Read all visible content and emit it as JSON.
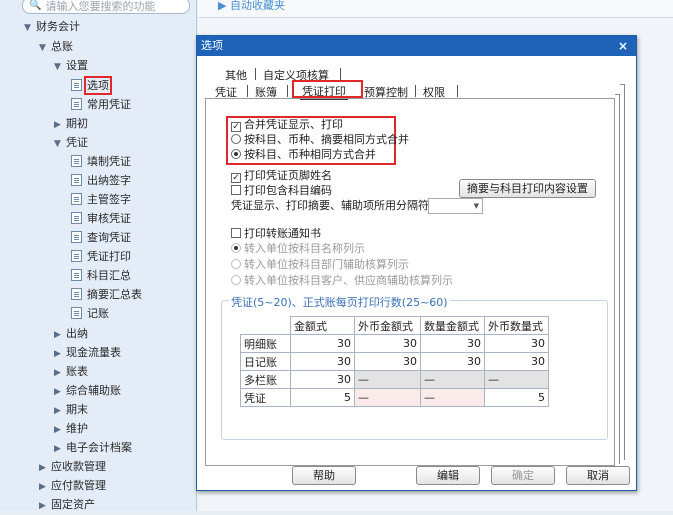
{
  "sidebar": {
    "search_placeholder": "请输入您要搜索的功能",
    "tree": [
      {
        "label": "财务会计",
        "arrow": "▼"
      },
      {
        "label": "总账",
        "arrow": "▼"
      },
      {
        "label": "设置",
        "arrow": "▼"
      },
      {
        "label": "选项",
        "icon": "doc"
      },
      {
        "label": "常用凭证",
        "icon": "doc"
      },
      {
        "label": "期初",
        "arrow": "▶"
      },
      {
        "label": "凭证",
        "arrow": "▼"
      },
      {
        "label": "填制凭证",
        "icon": "doc"
      },
      {
        "label": "出纳签字",
        "icon": "doc"
      },
      {
        "label": "主管签字",
        "icon": "doc"
      },
      {
        "label": "审核凭证",
        "icon": "doc"
      },
      {
        "label": "查询凭证",
        "icon": "doc"
      },
      {
        "label": "凭证打印",
        "icon": "doc"
      },
      {
        "label": "科目汇总",
        "icon": "doc"
      },
      {
        "label": "摘要汇总表",
        "icon": "doc"
      },
      {
        "label": "记账",
        "icon": "doc"
      },
      {
        "label": "出纳",
        "arrow": "▶"
      },
      {
        "label": "现金流量表",
        "arrow": "▶"
      },
      {
        "label": "账表",
        "arrow": "▶"
      },
      {
        "label": "综合辅助账",
        "arrow": "▶"
      },
      {
        "label": "期末",
        "arrow": "▶"
      },
      {
        "label": "维护",
        "arrow": "▶"
      },
      {
        "label": "电子会计档案",
        "arrow": "▶"
      },
      {
        "label": "应收款管理",
        "arrow": "▶"
      },
      {
        "label": "应付款管理",
        "arrow": "▶"
      },
      {
        "label": "固定资产",
        "arrow": "▶"
      }
    ]
  },
  "main": {
    "top_link": "▶ 自动收藏夹"
  },
  "dialog": {
    "title": "选项",
    "close": "×",
    "tabs_row1": [
      "其他",
      "自定义项核算"
    ],
    "tabs_row2": [
      "凭证",
      "账簿",
      "凭证打印",
      "预算控制",
      "权限"
    ],
    "active_tab": "凭证打印",
    "opt_merge": "合并凭证显示、打印",
    "opt_merge_checked": true,
    "radio_a": "按科目、币种、摘要相同方式合并",
    "radio_b": "按科目、币种相同方式合并",
    "opt_footer": "打印凭证页脚姓名",
    "opt_footer_checked": true,
    "opt_code": "打印包含科目编码",
    "btn_summary": "摘要与科目打印内容设置",
    "sep_label": "凭证显示、打印摘要、辅助项所用分隔符",
    "opt_transfer": "打印转账通知书",
    "radio_t1": "转入单位按科目名称列示",
    "radio_t2": "转入单位按科目部门辅助核算列示",
    "radio_t3": "转入单位按科目客户、供应商辅助核算列示",
    "group_label": "凭证(5~20)、正式账每页打印行数(25~60)",
    "table": {
      "headers": [
        "",
        "金额式",
        "外币金额式",
        "数量金额式",
        "外币数量式"
      ],
      "rows": [
        [
          "明细账",
          "30",
          "30",
          "30",
          "30"
        ],
        [
          "日记账",
          "30",
          "30",
          "30",
          "30"
        ],
        [
          "多栏账",
          "30",
          "—",
          "—",
          "—"
        ],
        [
          "凭证",
          "5",
          "—",
          "—",
          "5"
        ]
      ]
    },
    "buttons": {
      "help": "帮助",
      "edit": "编辑",
      "ok": "确定",
      "cancel": "取消"
    }
  },
  "colors": {
    "title_bar": "#1e63b8",
    "highlight": "#e0282a",
    "group_label": "#3b6fb3"
  }
}
